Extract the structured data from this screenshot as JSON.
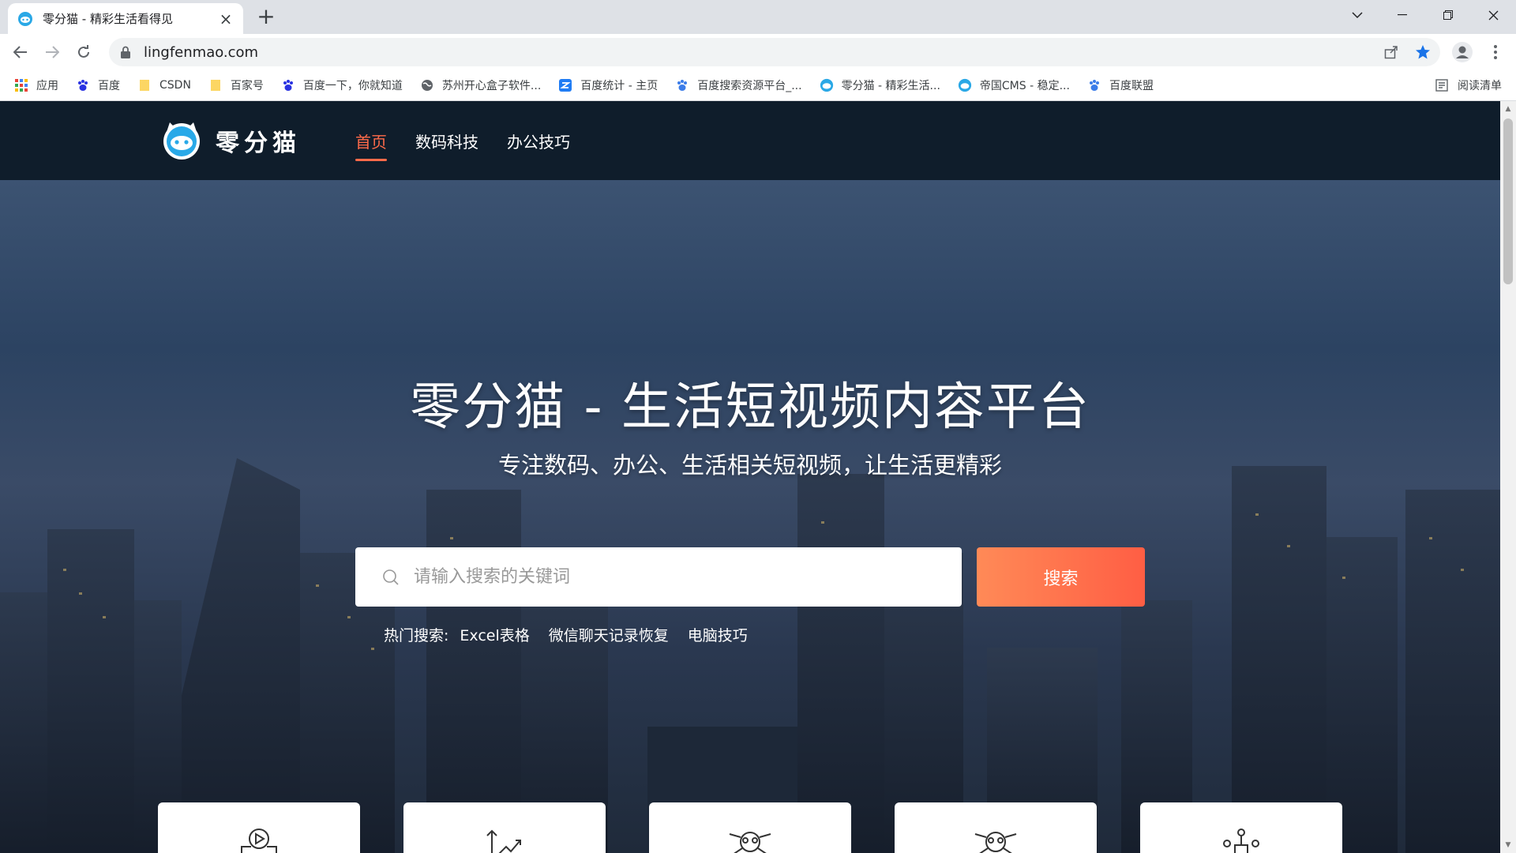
{
  "browser": {
    "tab_title": "零分猫 - 精彩生活看得见",
    "url": "lingfenmao.com",
    "bookmarks": [
      {
        "label": "应用",
        "icon": "apps-grid-icon"
      },
      {
        "label": "百度",
        "icon": "baidu-paw-icon"
      },
      {
        "label": "CSDN",
        "icon": "folder-icon"
      },
      {
        "label": "百家号",
        "icon": "folder-icon"
      },
      {
        "label": "百度一下，你就知道",
        "icon": "baidu-paw-icon"
      },
      {
        "label": "苏州开心盒子软件...",
        "icon": "globe-icon"
      },
      {
        "label": "百度统计 - 主页",
        "icon": "baidu-tongji-icon"
      },
      {
        "label": "百度搜索资源平台_...",
        "icon": "baidu-paw-icon"
      },
      {
        "label": "零分猫 - 精彩生活...",
        "icon": "lingfenmao-icon"
      },
      {
        "label": "帝国CMS - 稳定...",
        "icon": "lingfenmao-icon"
      },
      {
        "label": "百度联盟",
        "icon": "baidu-paw-icon"
      }
    ],
    "reading_list": "阅读清单"
  },
  "site": {
    "brand": "零分猫",
    "nav": [
      "首页",
      "数码科技",
      "办公技巧"
    ],
    "active_nav": "首页"
  },
  "hero": {
    "title": "零分猫 - 生活短视频内容平台",
    "subtitle": "专注数码、办公、生活相关短视频，让生活更精彩",
    "search_placeholder": "请输入搜索的关键词",
    "search_button": "搜索",
    "hot_label": "热门搜索:",
    "hot_items": [
      "Excel表格",
      "微信聊天记录恢复",
      "电脑技巧"
    ]
  },
  "colors": {
    "accent": "#ff6b4a",
    "header_bg": "#0f1d2b"
  }
}
